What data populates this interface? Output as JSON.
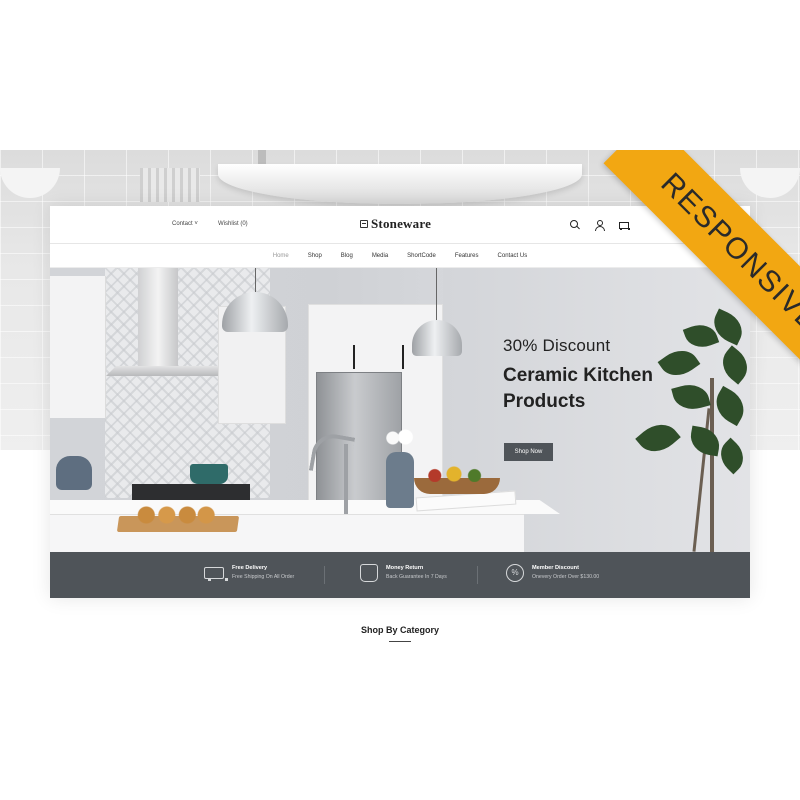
{
  "header": {
    "contact_label": "Contact ˅",
    "wishlist_label": "Wishlist (0)",
    "brand_name": "Stoneware",
    "icons": [
      "search-icon",
      "user-icon",
      "cart-icon"
    ]
  },
  "nav": {
    "items": [
      "Home",
      "Shop",
      "Blog",
      "Media",
      "ShortCode",
      "Features",
      "Contact Us"
    ],
    "active": "Home"
  },
  "hero": {
    "discount": "30% Discount",
    "title": "Ceramic Kitchen Products",
    "button": "Shop Now"
  },
  "features": [
    {
      "icon": "truck-icon",
      "title": "Free Delivery",
      "subtitle": "Free Shipping On All Order"
    },
    {
      "icon": "money-bag-icon",
      "title": "Money Return",
      "subtitle": "Back Guarantee In 7 Days"
    },
    {
      "icon": "percent-icon",
      "title": "Member Discount",
      "subtitle": "Onevery Order Over $130.00"
    }
  ],
  "section": {
    "title": "Shop By Category"
  },
  "ribbon": {
    "label": "RESPONSIVE"
  },
  "colors": {
    "accent": "#f2a712",
    "strip": "#4f5459",
    "button": "#4f5459",
    "text": "#222222"
  }
}
